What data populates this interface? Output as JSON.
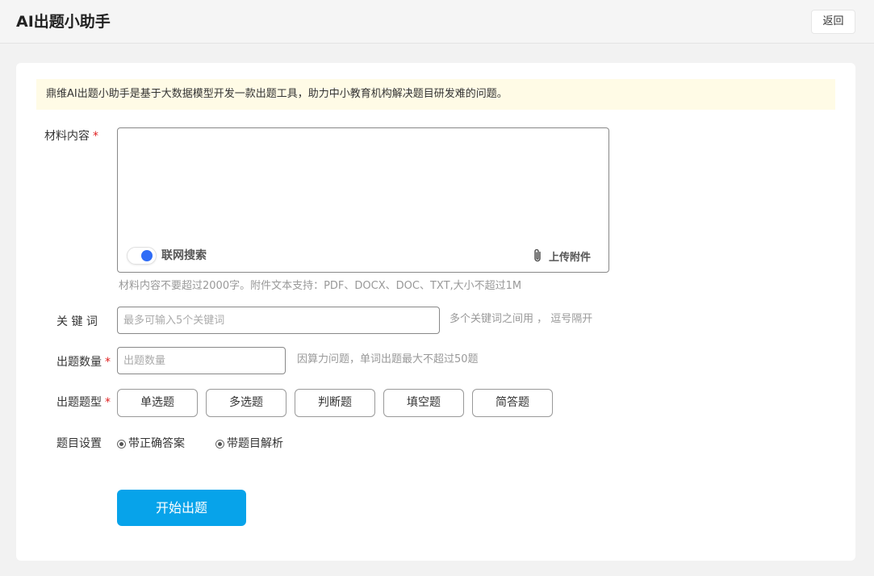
{
  "header": {
    "title": "AI出题小助手",
    "back_label": "返回"
  },
  "notice": "鼎维AI出题小助手是基于大数据模型开发一款出题工具，助力中小教育机构解决题目研发难的问题。",
  "material": {
    "label": "材料内容",
    "required_mark": "*",
    "value": "",
    "web_search_label": "联网搜索",
    "web_search_on": true,
    "upload_label": "上传附件",
    "hint": "材料内容不要超过2000字。附件文本支持：PDF、DOCX、DOC、TXT,大小不超过1M"
  },
  "keywords": {
    "label": "关 键 词",
    "placeholder": "最多可输入5个关键词",
    "hint": "多个关键词之间用 ， 逗号隔开"
  },
  "count": {
    "label": "出题数量",
    "required_mark": "*",
    "placeholder": "出题数量",
    "hint": "因算力问题，单词出题最大不超过50题"
  },
  "question_type": {
    "label": "出题题型",
    "required_mark": "*",
    "options": [
      "单选题",
      "多选题",
      "判断题",
      "填空题",
      "简答题"
    ]
  },
  "settings": {
    "label": "题目设置",
    "options": [
      {
        "label": "带正确答案",
        "checked": true
      },
      {
        "label": "带题目解析",
        "checked": true
      }
    ]
  },
  "submit_label": "开始出题",
  "colors": {
    "accent": "#07a3ea",
    "toggle": "#2f6cf6",
    "required": "#e02020",
    "notice_bg": "#fffbe6"
  }
}
